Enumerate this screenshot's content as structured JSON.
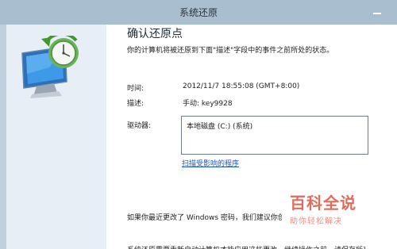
{
  "window": {
    "title": "系统还原"
  },
  "icons": {
    "app": "system-restore-icon",
    "minimize": "minimize-icon"
  },
  "page": {
    "heading": "确认还原点",
    "description": "你的计算机将被还原到下面\"描述\"字段中的事件之前所处的状态。",
    "time_label": "时间:",
    "time_value": "2012/11/7 18:55:08 (GMT+8:00)",
    "desc_label": "描述:",
    "desc_value": "手动: key9928",
    "drives_label": "驱动器:",
    "drives": [
      "本地磁盘 (C:) (系统)"
    ],
    "scan_link": "扫描受影响的程序",
    "password_note": "如果你最近更改了 Windows 密码，我们建议你创",
    "bottom_note": "系统还原需要重新启动计算机才能应用这些更改。继续操作之前，请保存所有"
  },
  "watermark": {
    "title": "百科全说",
    "subtitle": "助你轻松解决"
  },
  "colors": {
    "titlebar": "#a9bfd0",
    "left_panel": "#e8eef6",
    "link": "#1a56b5",
    "watermark": "#e36b5a"
  }
}
